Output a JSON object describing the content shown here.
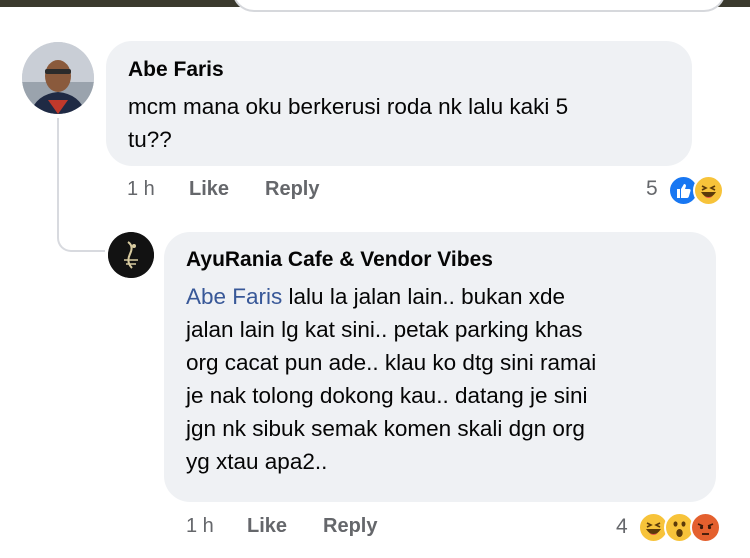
{
  "comment1": {
    "author": "Abe Faris",
    "text_line1": "mcm mana oku berkerusi roda nk lalu kaki 5",
    "text_line2": "tu??",
    "time": "1 h",
    "like_label": "Like",
    "reply_label": "Reply",
    "reaction_count": "5",
    "reactions": [
      "like-icon",
      "haha-icon"
    ]
  },
  "comment2": {
    "author": "AyuRania Cafe & Vendor Vibes",
    "mention": "Abe Faris",
    "text_line1_rest": " lalu la jalan lain.. bukan xde",
    "text_line2": "jalan lain lg kat sini.. petak parking khas",
    "text_line3": "org cacat pun ade.. klau ko dtg sini ramai",
    "text_line4": "je nak tolong dokong kau.. datang je sini",
    "text_line5": "jgn nk sibuk semak komen skali dgn org",
    "text_line6": "yg xtau apa2..",
    "time": "1 h",
    "like_label": "Like",
    "reply_label": "Reply",
    "reaction_count": "4",
    "reactions": [
      "haha-icon",
      "wow-icon",
      "angry-icon"
    ]
  },
  "colors": {
    "bubble": "#eff1f4",
    "meta": "#65676b",
    "mention": "#385898",
    "like_blue": "#1877f2",
    "emoji_yellow": "#f7c33a",
    "angry_red": "#e4602e"
  }
}
